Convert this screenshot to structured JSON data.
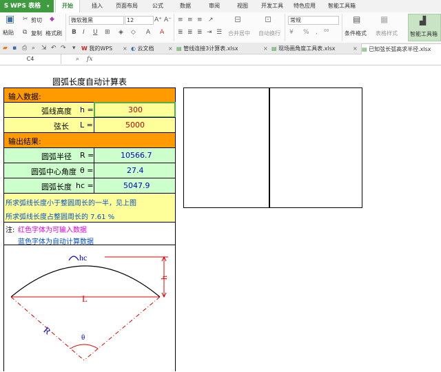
{
  "app": {
    "logo": "S",
    "name": "WPS 表格"
  },
  "menu": [
    "开始",
    "插入",
    "页面布局",
    "公式",
    "数据",
    "审阅",
    "视图",
    "开发工具",
    "特色应用",
    "智能工具箱"
  ],
  "ribbon": {
    "cut": "剪切",
    "paste": "粘贴",
    "copy": "复制",
    "format_painter": "格式刷",
    "font_name": "微软雅黑",
    "font_size": "12",
    "merge_center": "合并居中",
    "wrap_text": "自动换行",
    "number_format": "常规",
    "conditional_format": "条件格式",
    "table_style": "表格样式",
    "smart_toolbox": "智能工具箱"
  },
  "tabs": [
    "我的WPS",
    "云文档",
    "管线连接3计算表.xlsx",
    "现场画角度工具表.xlsx",
    "已知弦长弧高求半径.xlsx"
  ],
  "formula_bar": {
    "cell_ref": "C4",
    "fx": "fx"
  },
  "sheet": {
    "title": "圆弧长度自动计算表",
    "input_header": "输入数据:",
    "arc_height_label": "弧线高度",
    "h_sym": "h =",
    "arc_height_value": "300",
    "chord_label": "弦长",
    "L_sym": "L =",
    "chord_value": "5000",
    "output_header": "输出结果:",
    "radius_label": "圆弧半径",
    "R_sym": "R =",
    "radius_value": "10566.7",
    "angle_label": "圆弧中心角度",
    "theta_sym": "θ =",
    "angle_value": "27.4",
    "arc_len_label": "圆弧长度",
    "hc_sym": "hc =",
    "arc_len_value": "5047.9",
    "note1": "所求弧线长度小于整圆周长的一半，见上图",
    "note2": "所求弧线长度占整圆周长的 7.61 %",
    "legend_prefix": "注:",
    "legend_red": "红色字体为可输入数据",
    "legend_blue": "蓝色字体为自动计算数据",
    "diagram": {
      "hc": "hc",
      "L": "L",
      "R": "R",
      "theta": "θ",
      "h": "h"
    }
  }
}
